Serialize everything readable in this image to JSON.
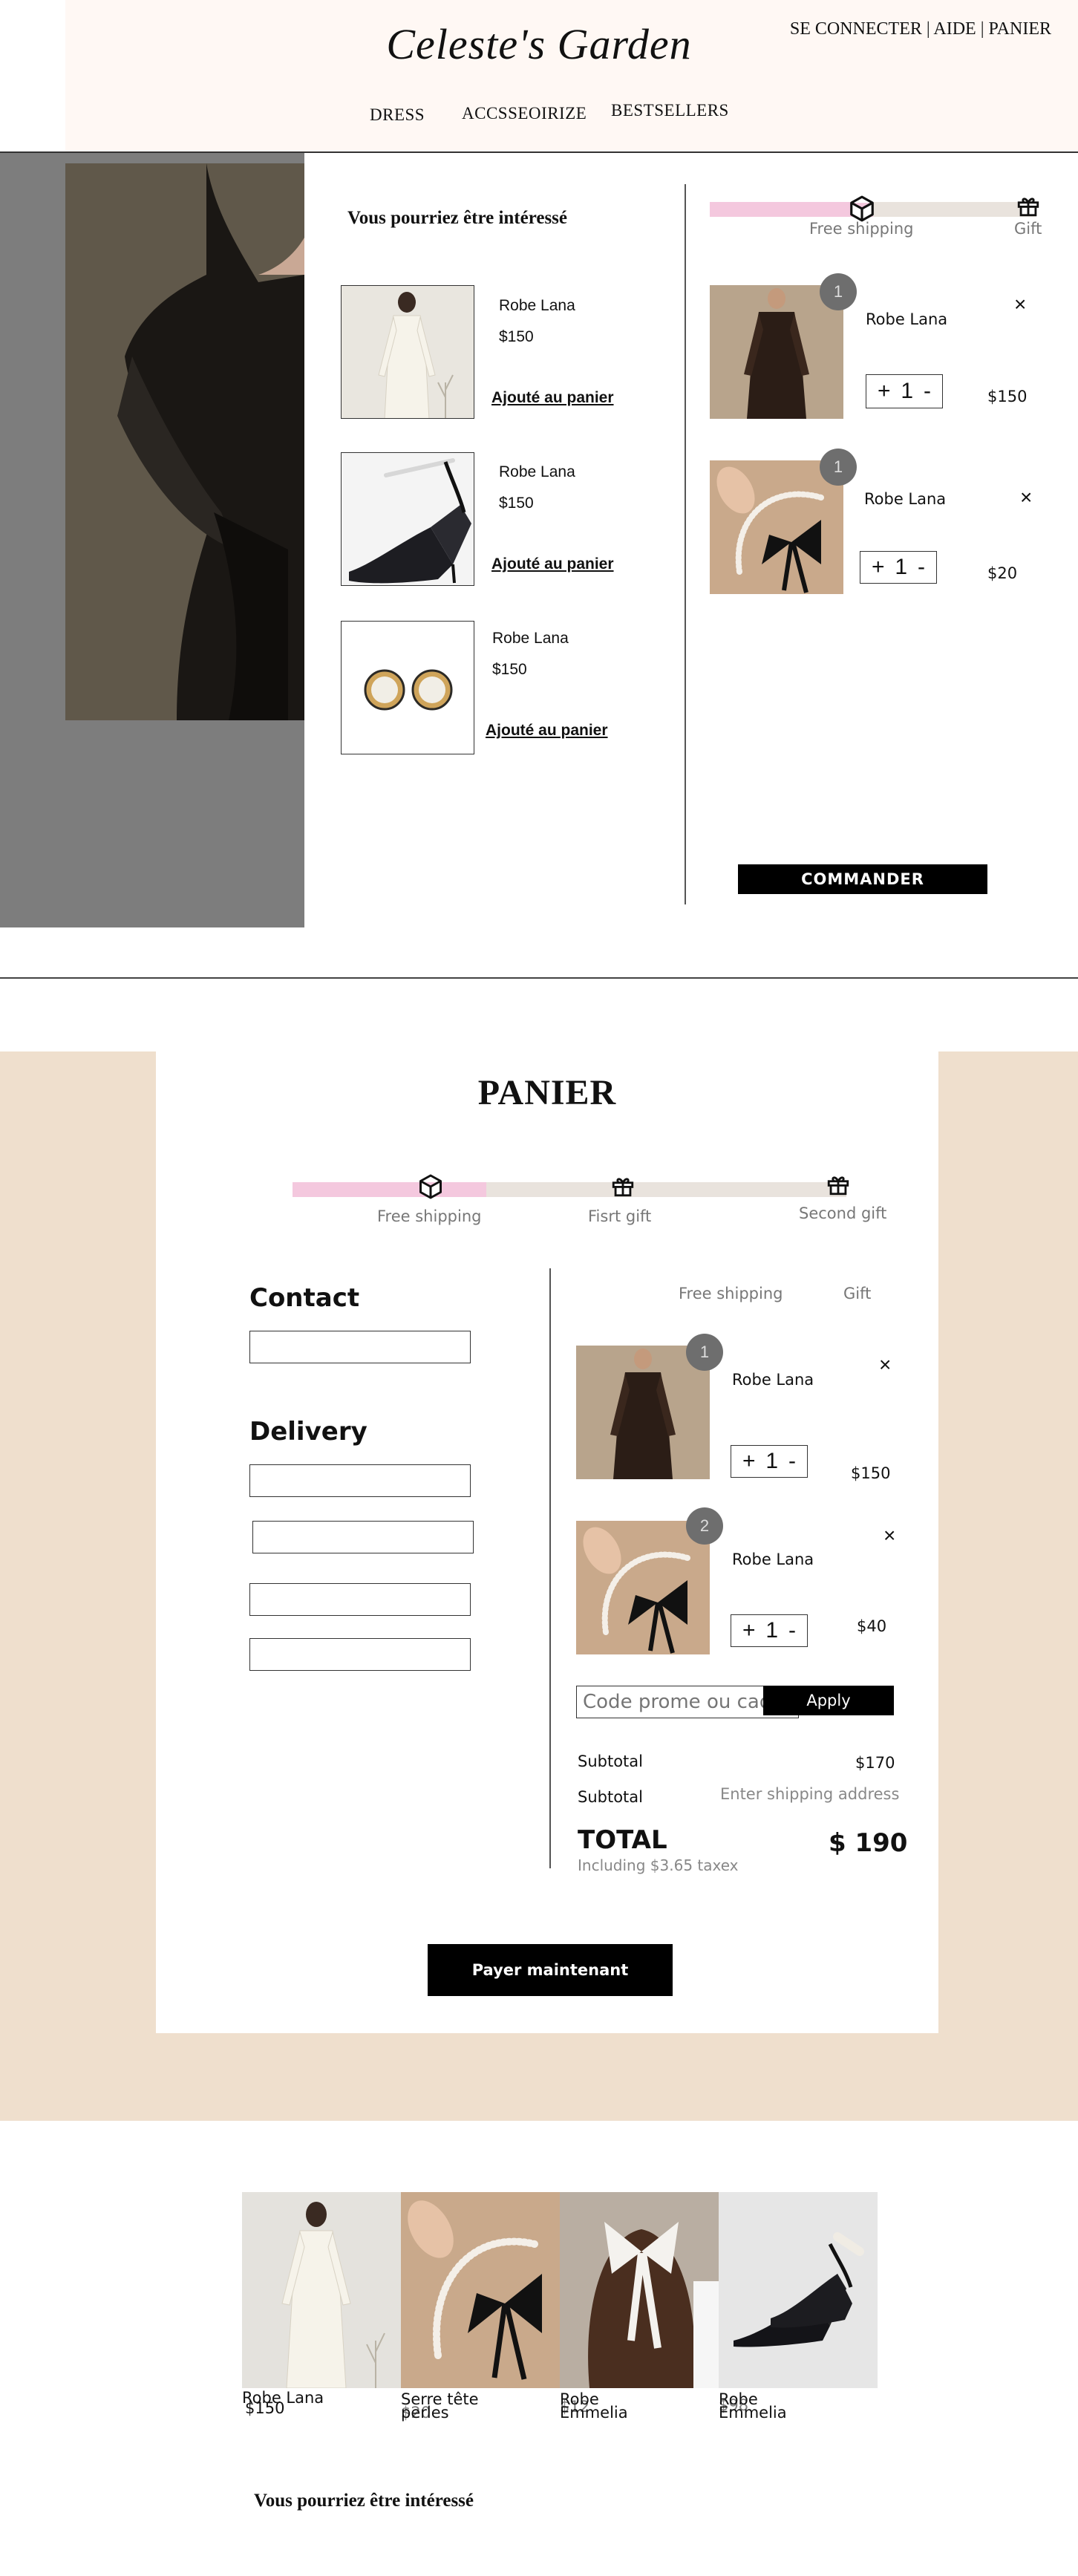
{
  "header": {
    "brand": "Celeste's Garden",
    "links": {
      "login": "SE CONNECTER",
      "sep1": "|",
      "help": "AIDE",
      "sep2": "|",
      "cart": "PANIER"
    },
    "nav": [
      "DRESS",
      "ACCSSEOIRIZE",
      "BESTSELLERS"
    ]
  },
  "drawer": {
    "suggestions_title": "Vous pourriez être intéressé",
    "suggestions": [
      {
        "name": "Robe Lana",
        "price": "$150",
        "action": "Ajouté au panier"
      },
      {
        "name": "Robe Lana",
        "price": "$150",
        "action": "Ajouté au panier"
      },
      {
        "name": "Robe Lana",
        "price": "$150",
        "action": "Ajouté au panier"
      }
    ],
    "progress": {
      "label_1": "Free shipping",
      "label_2": "Gift",
      "fill_fraction": 0.5
    },
    "cart_items": [
      {
        "badge": "1",
        "name": "Robe Lana",
        "qty": "1",
        "plus": "+",
        "minus": "-",
        "price": "$150",
        "close": "×"
      },
      {
        "badge": "1",
        "name": "Robe Lana",
        "qty": "1",
        "plus": "+",
        "minus": "-",
        "price": "$20",
        "close": "×"
      }
    ],
    "checkout_button": "COMMANDER"
  },
  "checkout": {
    "title": "PANIER",
    "progress": {
      "label_1": "Free shipping",
      "label_2": "Fisrt gift",
      "label_3": "Second gift",
      "fill_fraction": 0.35
    },
    "contact_heading": "Contact",
    "delivery_heading": "Delivery",
    "cart_header": {
      "col1": "Free shipping",
      "col2": "Gift"
    },
    "items": [
      {
        "badge": "1",
        "name": "Robe Lana",
        "qty": "1",
        "plus": "+",
        "minus": "-",
        "price": "$150",
        "close": "×"
      },
      {
        "badge": "2",
        "name": "Robe Lana",
        "qty": "1",
        "plus": "+",
        "minus": "-",
        "price": "$40",
        "close": "×"
      }
    ],
    "promo_placeholder": "Code prome ou cadeau",
    "apply_label": "Apply",
    "subtotal_label": "Subtotal",
    "subtotal_value": "$170",
    "shipping_label": "Subtotal",
    "shipping_value": "Enter shipping address",
    "total_label": "TOTAL",
    "total_value": "$ 190",
    "tax_note": "Including $3.65 taxex",
    "pay_button": "Payer maintenant"
  },
  "strip": [
    {
      "name": "Robe Lana",
      "price": "$150"
    },
    {
      "name": "Serre tête perles",
      "price": "$20"
    },
    {
      "name": "Robe Emmelia",
      "price": "$12"
    },
    {
      "name": "Robe Emmelia",
      "price": "$98"
    }
  ],
  "bottom_title": "Vous pourriez être intéressé",
  "colors": {
    "header_bg": "#fff8f4",
    "beige": "#efdfcd",
    "progress_pink": "#f4c8de",
    "track": "#e9e3dd"
  }
}
